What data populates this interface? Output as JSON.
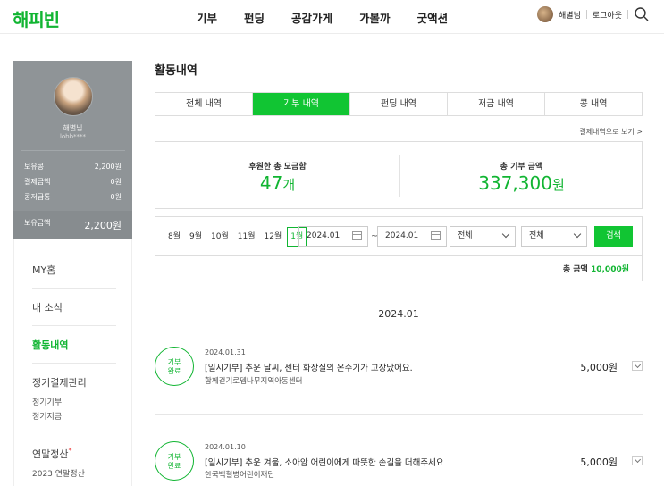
{
  "header": {
    "logo": "해피빈",
    "nav": [
      "기부",
      "펀딩",
      "공감가게",
      "가볼까",
      "굿액션"
    ],
    "user_name": "해별님",
    "logout": "로그아웃"
  },
  "sidebar": {
    "profile": {
      "name": "해별님",
      "id": "lobb****",
      "balances": [
        {
          "label": "보유콩",
          "value": "2,200원"
        },
        {
          "label": "결제금액",
          "value": "0원"
        },
        {
          "label": "콩저금통",
          "value": "0원"
        }
      ],
      "total_label": "보유금액",
      "total_value": "2,200원"
    },
    "menu": [
      {
        "label": "MY홈"
      },
      {
        "label": "내 소식"
      },
      {
        "label": "활동내역"
      },
      {
        "label": "정기결제관리"
      },
      {
        "label": "연말정산"
      }
    ],
    "sub_regular": [
      "정기기부",
      "정기저금"
    ],
    "sub_tax": [
      "2023 연말정산"
    ],
    "tax_required_mark": "*"
  },
  "main": {
    "title": "활동내역",
    "tabs": [
      "전체 내역",
      "기부 내역",
      "펀딩 내역",
      "저금 내역",
      "콩 내역"
    ],
    "active_tab": 1,
    "view_payment_link": "결제내역으로 보기 >",
    "summary": {
      "count_label": "후원한 총 모금함",
      "count_value": "47",
      "count_unit": "개",
      "amount_label": "총 기부 금액",
      "amount_value": "337,300",
      "amount_unit": "원"
    },
    "filter": {
      "months": [
        "8월",
        "9월",
        "10월",
        "11월",
        "12월",
        "1월"
      ],
      "active_month": 5,
      "date_from": "2024.01",
      "date_to": "2024.01",
      "tilde": "~",
      "select1": "전체",
      "select2": "전체",
      "search_button": "검색"
    },
    "total": {
      "label": "총 금액",
      "value": "10,000원"
    },
    "month_header": "2024.01",
    "items": [
      {
        "badge_line1": "기부",
        "badge_line2": "완료",
        "date": "2024.01.31",
        "title": "[일시기부] 추운 날씨, 센터 화장실의 온수기가 고장났어요.",
        "org": "함께걷기로뎀나무지역아동센터",
        "amount": "5,000원"
      },
      {
        "badge_line1": "기부",
        "badge_line2": "완료",
        "date": "2024.01.10",
        "title": "[일시기부] 추운 겨울, 소아암 어린이에게 따뜻한 손길을 더해주세요",
        "org": "한국백혈병어린이재단",
        "amount": "5,000원"
      }
    ]
  },
  "colors": {
    "brand_green": "#11b532",
    "sidebar_gray": "#8f9497"
  }
}
